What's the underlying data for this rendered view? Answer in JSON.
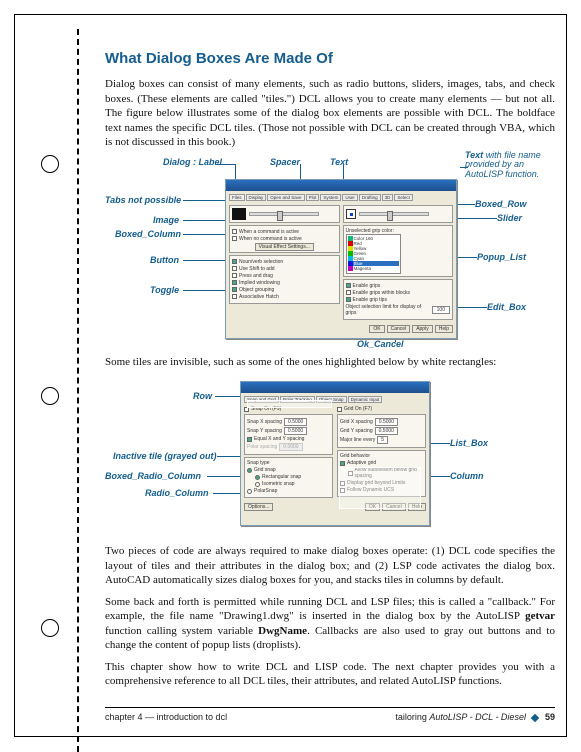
{
  "heading": "What Dialog Boxes Are Made Of",
  "para1": "Dialog boxes can consist of many elements, such as radio buttons, sliders, images, tabs, and check boxes. (These elements are called \"tiles.\") DCL allows you to create many elements — but not all. The figure below illustrates some of the dialog box elements are possible with DCL. The boldface text names the specific DCL tiles. (Those not possible with DCL can be created through VBA, which is not discussed in this book.)",
  "para2": "Some tiles are invisible, such as some of the ones highlighted below by white rectangles:",
  "para3_a": "Two pieces of code are always required to make dialog boxes operate:  (1) DCL code specifies the layout of tiles and their attributes in the dialog box; and (2) LSP code activates the dialog box. AutoCAD automatically sizes dialog boxes for you, and stacks tiles in columns by default.",
  "para3_b_pre": "Some back and forth is permitted while running DCL and LSP files; this is called a \"callback.\" For example, the file name \"Drawing1.dwg\" is inserted in the dialog box by the AutoLISP ",
  "para3_b_bold1": "getvar",
  "para3_b_mid": " function calling system variable ",
  "para3_b_bold2": "DwgName",
  "para3_b_post": ". Callbacks are also used to gray out buttons and to change the content of popup lists (droplists).",
  "para4": "This chapter show how to write DCL and LISP code. The next chapter provides you with a comprehensive reference to all DCL tiles, their attributes, and related AutoLISP functions.",
  "callouts_fig1": {
    "dialog_label": "Dialog : Label",
    "spacer": "Spacer",
    "text": "Text",
    "text_note": "Text with file name provided by an AutoLISP function.",
    "tabs_not_possible": "Tabs not possible",
    "boxed_row": "Boxed_Row",
    "image": "Image",
    "slider": "Slider",
    "boxed_column": "Boxed_Column",
    "button": "Button",
    "popup_list": "Popup_List",
    "toggle": "Toggle",
    "edit_box": "Edit_Box",
    "ok_cancel": "Ok_Cancel"
  },
  "callouts_fig2": {
    "row": "Row",
    "inactive": "Inactive tile (grayed out)",
    "boxed_radio_column": "Boxed_Radio_Column",
    "radio_column": "Radio_Column",
    "list_box": "List_Box",
    "column": "Column"
  },
  "footer": {
    "left": "chapter 4 — introduction to dcl",
    "right_prefix": "tailoring ",
    "right_em": "AutoLISP - DCL - Diesel",
    "page": "59"
  }
}
